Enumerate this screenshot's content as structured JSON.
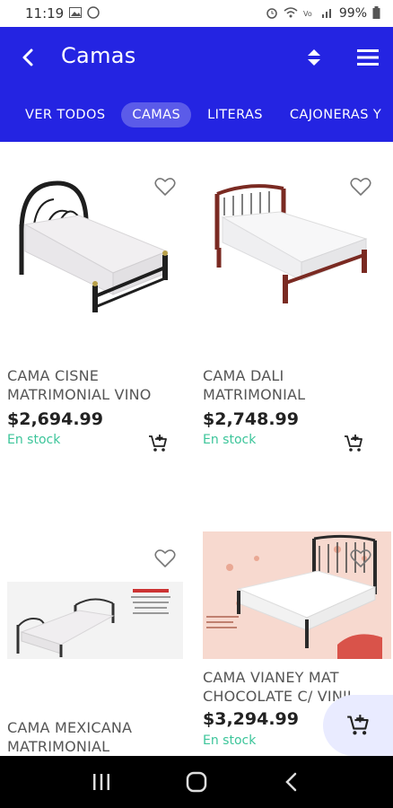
{
  "status_bar": {
    "time": "11:19",
    "battery": "99%"
  },
  "app_bar": {
    "title": "Camas"
  },
  "tabs": [
    {
      "label": "VER TODOS",
      "active": false
    },
    {
      "label": "CAMAS",
      "active": true
    },
    {
      "label": "LITERAS",
      "active": false
    },
    {
      "label": "CAJONERAS Y",
      "active": false
    }
  ],
  "products": [
    {
      "name_line1": "CAMA CISNE",
      "name_line2": "MATRIMONIAL VINO",
      "price": "$2,694.99",
      "stock": "En stock"
    },
    {
      "name_line1": "CAMA DALI",
      "name_line2": "MATRIMONIAL",
      "price": "$2,748.99",
      "stock": "En stock"
    },
    {
      "name_line1": "CAMA MEXICANA",
      "name_line2": "MATRIMONIAL",
      "price": "",
      "stock": ""
    },
    {
      "name_line1": "CAMA VIANEY MAT",
      "name_line2": "CHOCOLATE C/ VINIL",
      "price": "$3,294.99",
      "stock": "En stock"
    }
  ],
  "colors": {
    "primary": "#2424e2",
    "stock": "#3cc59a",
    "float_cart_bg": "#e9ebff"
  }
}
